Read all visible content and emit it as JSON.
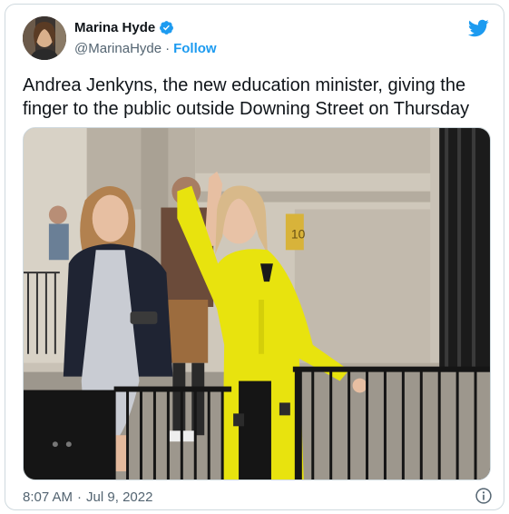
{
  "author": {
    "name": "Marina Hyde",
    "handle": "@MarinaHyde",
    "separator": "·",
    "follow_label": "Follow"
  },
  "tweet": {
    "text": "Andrea Jenkyns, the new education minister, giving the finger to the public outside Downing Street on Thursday",
    "time": "8:07 AM",
    "date_separator": "·",
    "date": "Jul 9, 2022"
  },
  "media": {
    "door_sign": "10"
  },
  "icons": {
    "verified": "verified-badge-icon",
    "brand": "twitter-bird-icon",
    "info": "info-icon"
  },
  "colors": {
    "brand_blue": "#1d9bf0",
    "text_primary": "#0f1419",
    "text_secondary": "#536471",
    "border": "#cfd9de"
  }
}
